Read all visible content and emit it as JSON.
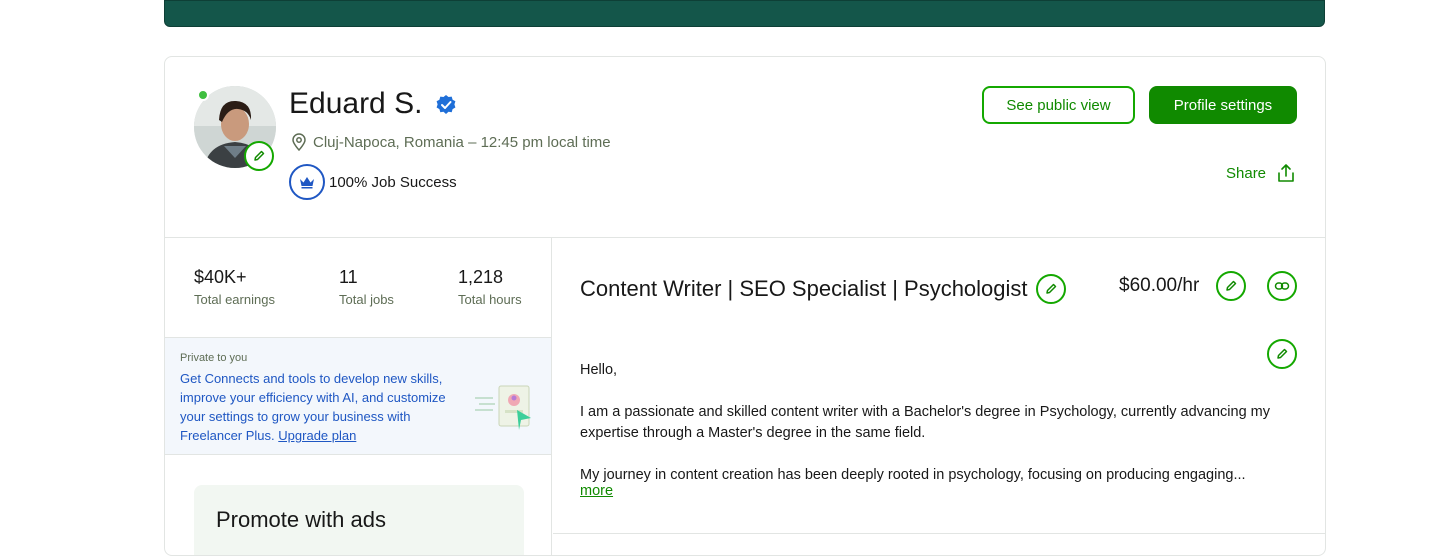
{
  "profile": {
    "name": "Eduard S.",
    "location": "Cluj-Napoca, Romania – 12:45 pm local time",
    "job_success": "100% Job Success"
  },
  "actions": {
    "public_view": "See public view",
    "settings": "Profile settings",
    "share": "Share"
  },
  "stats": [
    {
      "value": "$40K+",
      "label": "Total earnings"
    },
    {
      "value": "11",
      "label": "Total jobs"
    },
    {
      "value": "1,218",
      "label": "Total hours"
    }
  ],
  "private_box": {
    "heading": "Private to you",
    "message": "Get Connects and tools to develop new skills, improve your efficiency with AI, and customize your settings to grow your business with Freelancer Plus.",
    "link": "Upgrade plan"
  },
  "promote": {
    "title": "Promote with ads"
  },
  "overview": {
    "title": "Content Writer | SEO Specialist | Psychologist",
    "rate": "$60.00/hr",
    "bio": [
      "Hello,",
      "I am a passionate and skilled content writer with a Bachelor's degree in Psychology, currently advancing my expertise through a Master's degree in the same field.",
      "My journey in content creation has been deeply rooted in psychology, focusing on producing engaging..."
    ],
    "more": "more"
  },
  "colors": {
    "brand_green": "#108a00",
    "topbar": "#14564a",
    "link_blue": "#1f57c3"
  }
}
